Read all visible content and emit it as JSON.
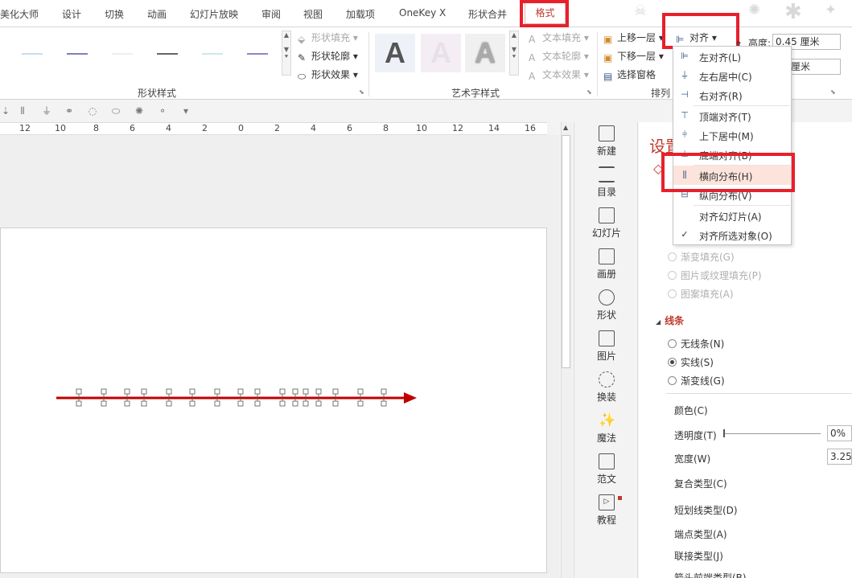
{
  "tabs": [
    "美化大师",
    "设计",
    "切换",
    "动画",
    "幻灯片放映",
    "审阅",
    "视图",
    "加载项",
    "OneKey X",
    "形状合并",
    "格式"
  ],
  "ribbon": {
    "shape_styles_title": "形状样式",
    "shape_fill": "形状填充",
    "shape_outline": "形状轮廓",
    "shape_effect": "形状效果",
    "wordart_title": "艺术字样式",
    "text_fill": "文本填充",
    "text_outline": "文本轮廓",
    "text_effect": "文本效果",
    "bring_forward": "上移一层",
    "send_backward": "下移一层",
    "selection_pane": "选择窗格",
    "align_button": "对齐",
    "arrange_title": "排列",
    "height_label": "高度:",
    "height_value": "0.45 厘米",
    "width_value": "厘米",
    "wordart_letter": "A",
    "line_colors": [
      "#c9dcee",
      "#7d7fb8",
      "#eeeeee",
      "#666666",
      "#cfe6ee",
      "#8d87c4"
    ]
  },
  "ruler": {
    "numbers": [
      "12",
      "10",
      "8",
      "6",
      "4",
      "2",
      "0",
      "2",
      "4",
      "6",
      "8",
      "10",
      "12",
      "14",
      "16"
    ]
  },
  "sidebar": [
    {
      "label": "新建",
      "icon": "new-doc-icon"
    },
    {
      "label": "目录",
      "icon": "list-icon"
    },
    {
      "label": "幻灯片",
      "icon": "slide-icon"
    },
    {
      "label": "画册",
      "icon": "album-icon"
    },
    {
      "label": "形状",
      "icon": "shape-icon"
    },
    {
      "label": "图片",
      "icon": "picture-icon"
    },
    {
      "label": "换装",
      "icon": "refresh-icon"
    },
    {
      "label": "魔法",
      "icon": "magic-wand-icon"
    },
    {
      "label": "范文",
      "icon": "template-icon"
    },
    {
      "label": "教程",
      "icon": "play-icon"
    }
  ],
  "panel": {
    "title": "设置",
    "fill_options": [
      "渐变填充(G)",
      "图片或纹理填充(P)",
      "图案填充(A)"
    ],
    "line_section": "线条",
    "line_options": [
      "无线条(N)",
      "实线(S)",
      "渐变线(G)"
    ],
    "color_label": "颜色(C)",
    "transparency_label": "透明度(T)",
    "transparency_value": "0%",
    "width_label": "宽度(W)",
    "width_value": "3.25",
    "compound_label": "复合类型(C)",
    "dash_label": "短划线类型(D)",
    "cap_label": "端点类型(A)",
    "join_label": "联接类型(J)",
    "arrow_front_label": "箭头前端类型(B)"
  },
  "align_menu": [
    {
      "label": "左对齐(L)",
      "icon": "align-left-icon"
    },
    {
      "label": "左右居中(C)",
      "icon": "align-center-icon"
    },
    {
      "label": "右对齐(R)",
      "icon": "align-right-icon"
    },
    {
      "label": "顶端对齐(T)",
      "icon": "align-top-icon"
    },
    {
      "label": "上下居中(M)",
      "icon": "align-middle-icon"
    },
    {
      "label": "底端对齐(B)",
      "icon": "align-bottom-icon"
    },
    {
      "label": "横向分布(H)",
      "icon": "distribute-horizontal-icon"
    },
    {
      "label": "纵向分布(V)",
      "icon": "distribute-vertical-icon"
    },
    {
      "label": "对齐幻灯片(A)",
      "icon": ""
    },
    {
      "label": "对齐所选对象(O)",
      "icon": "check-icon"
    }
  ],
  "slide": {
    "arrow_color": "#c00000",
    "marker_count": 16
  },
  "colors": {
    "accent": "#c0392b",
    "highlight_box": "#e8202c",
    "menu_hover": "#fce4dc"
  }
}
